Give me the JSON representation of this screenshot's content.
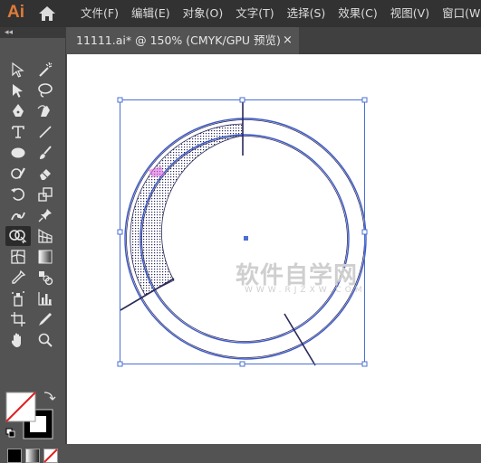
{
  "app": {
    "logo": "Ai"
  },
  "menu": [
    "文件(F)",
    "编辑(E)",
    "对象(O)",
    "文字(T)",
    "选择(S)",
    "效果(C)",
    "视图(V)",
    "窗口(W)"
  ],
  "toolbox": {
    "collapse_label": "◂◂",
    "tools": [
      "selection-tool",
      "direct-selection-tool",
      "pen-tool",
      "curvature-tool",
      "type-tool",
      "line-tool",
      "ellipse-tool",
      "paintbrush-tool",
      "shaper-tool",
      "eraser-tool",
      "rotate-tool",
      "scale-tool",
      "puppet-warp-tool",
      "pin-tool",
      "shape-builder-tool",
      "perspective-grid-tool",
      "mesh-tool",
      "gradient-tool",
      "eyedropper-tool",
      "blend-tool",
      "symbol-sprayer-tool",
      "column-graph-tool",
      "artboard-tool",
      "slice-tool",
      "hand-tool",
      "zoom-tool"
    ]
  },
  "document_tab": {
    "title": "11111.ai* @ 150% (CMYK/GPU 预览)",
    "close": "×"
  },
  "watermark": {
    "text": "软件自学网",
    "sub": "WWW.RJZXW.COM"
  },
  "colors": {
    "accent": "#e07b39",
    "path_blue": "#3a57c8",
    "selection_blue": "#4a6fd1"
  }
}
